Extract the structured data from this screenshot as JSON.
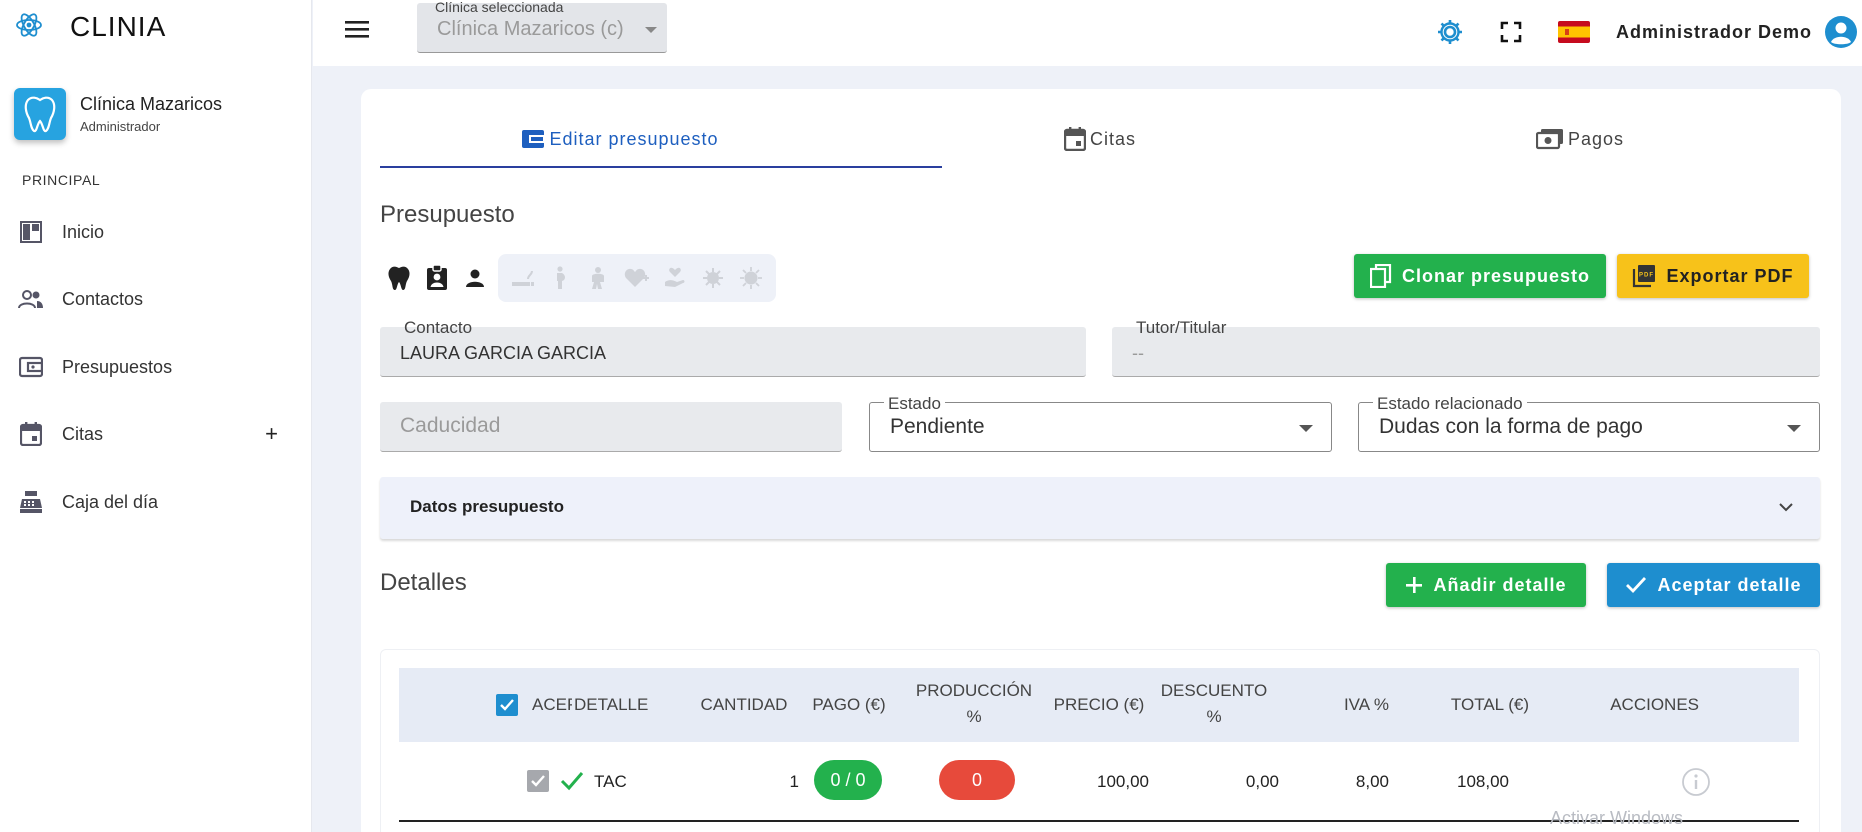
{
  "brand": {
    "name": "CLINIA",
    "logo_icon": "atom-icon",
    "accent": "#1e8ecf"
  },
  "clinic": {
    "name": "Clínica Mazaricos",
    "role": "Administrador"
  },
  "sidebar": {
    "section_title": "PRINCIPAL",
    "items": [
      {
        "label": "Inicio",
        "icon": "dashboard-icon"
      },
      {
        "label": "Contactos",
        "icon": "people-icon"
      },
      {
        "label": "Presupuestos",
        "icon": "wallet-icon"
      },
      {
        "label": "Citas",
        "icon": "calendar-icon",
        "extra": "+"
      },
      {
        "label": "Caja del día",
        "icon": "cash-register-icon"
      }
    ]
  },
  "header": {
    "clinic_select_label": "Clínica seleccionada",
    "clinic_select_value": "Clínica Mazaricos (c)",
    "user_name": "Administrador Demo"
  },
  "tabs": [
    {
      "label": "Editar presupuesto",
      "icon": "wallet-icon",
      "active": true
    },
    {
      "label": "Citas",
      "icon": "calendar-icon",
      "active": false
    },
    {
      "label": "Pagos",
      "icon": "payments-icon",
      "active": false
    }
  ],
  "presupuesto": {
    "title": "Presupuesto",
    "clone_label": "Clonar presupuesto",
    "export_label": "Exportar PDF",
    "contact_label": "Contacto",
    "contact_value": "LAURA GARCIA GARCIA",
    "tutor_label": "Tutor/Titular",
    "tutor_value": "--",
    "caducidad_placeholder": "Caducidad",
    "estado_label": "Estado",
    "estado_value": "Pendiente",
    "estado_rel_label": "Estado relacionado",
    "estado_rel_value": "Dudas con la forma de pago",
    "datos_label": "Datos presupuesto"
  },
  "detalles": {
    "title": "Detalles",
    "add_label": "Añadir detalle",
    "accept_label": "Aceptar detalle",
    "headers": {
      "acep": "ACEP",
      "detalle": "DETALLE",
      "cantidad": "CANTIDAD",
      "pago": "PAGO (€)",
      "produccion": "PRODUCCIÓN",
      "produccion_unit": "%",
      "precio": "PRECIO (€)",
      "descuento": "DESCUENTO",
      "descuento_unit": "%",
      "iva": "IVA %",
      "total": "TOTAL (€)",
      "acciones": "ACCIONES"
    },
    "rows": [
      {
        "detalle": "TAC",
        "cantidad": "1",
        "pago": "0 / 0",
        "produccion": "0",
        "precio": "100,00",
        "descuento": "0,00",
        "iva": "8,00",
        "total": "108,00"
      }
    ]
  },
  "watermark": "Activar Windows"
}
